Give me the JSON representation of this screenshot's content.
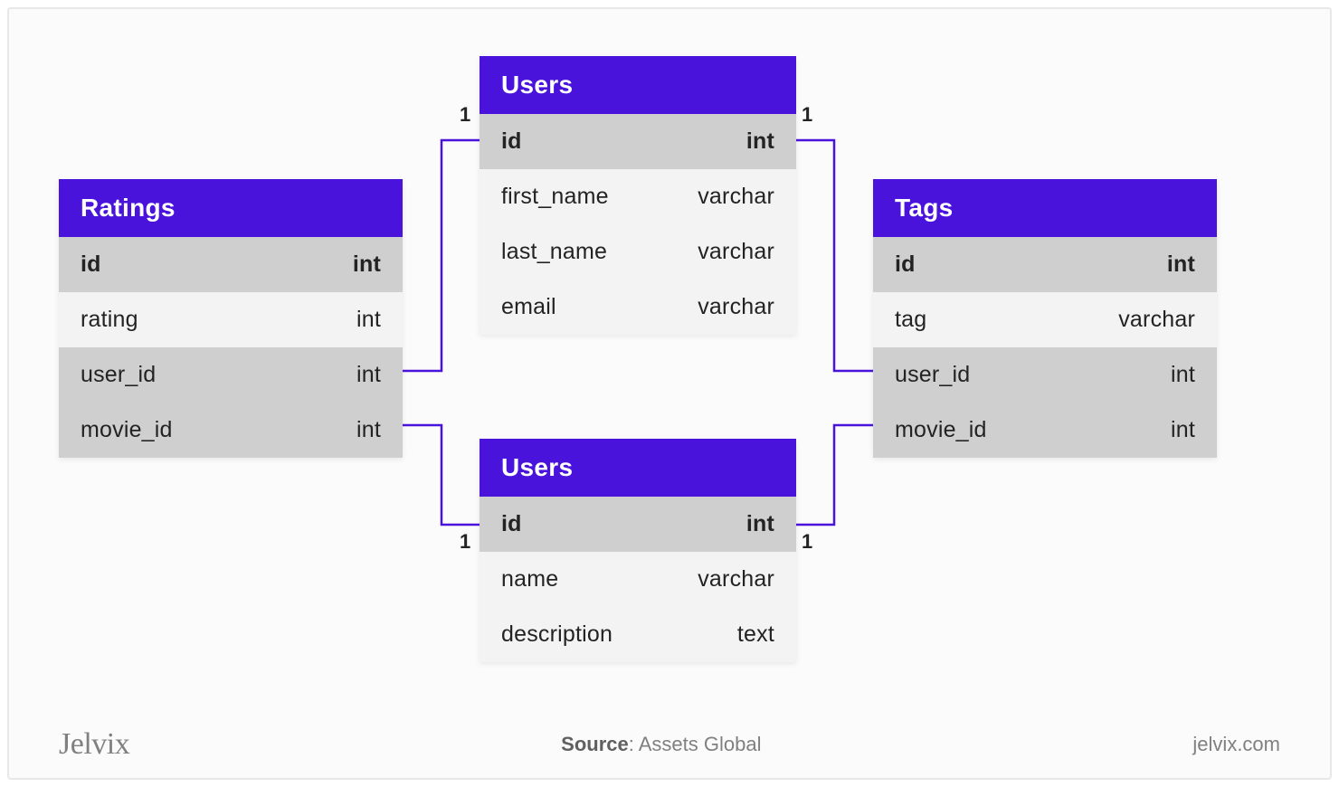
{
  "colors": {
    "accent": "#4a13db",
    "row_bg": "#f3f3f3",
    "key_bg": "#cfcfcf"
  },
  "tables": {
    "ratings": {
      "title": "Ratings",
      "rows": [
        {
          "name": "id",
          "type": "int",
          "key": true
        },
        {
          "name": "rating",
          "type": "int"
        },
        {
          "name": "user_id",
          "type": "int",
          "fk": true
        },
        {
          "name": "movie_id",
          "type": "int",
          "fk": true
        }
      ]
    },
    "users_top": {
      "title": "Users",
      "rows": [
        {
          "name": "id",
          "type": "int",
          "key": true
        },
        {
          "name": "first_name",
          "type": "varchar"
        },
        {
          "name": "last_name",
          "type": "varchar"
        },
        {
          "name": "email",
          "type": "varchar"
        }
      ]
    },
    "users_bottom": {
      "title": "Users",
      "rows": [
        {
          "name": "id",
          "type": "int",
          "key": true
        },
        {
          "name": "name",
          "type": "varchar"
        },
        {
          "name": "description",
          "type": "text"
        }
      ]
    },
    "tags": {
      "title": "Tags",
      "rows": [
        {
          "name": "id",
          "type": "int",
          "key": true
        },
        {
          "name": "tag",
          "type": "varchar"
        },
        {
          "name": "user_id",
          "type": "int",
          "fk": true
        },
        {
          "name": "movie_id",
          "type": "int",
          "fk": true
        }
      ]
    }
  },
  "cardinality": {
    "top_left": "1",
    "top_right": "1",
    "bottom_left": "1",
    "bottom_right": "1"
  },
  "footer": {
    "brand": "Jelvix",
    "source_label": "Source",
    "source_value": "Assets Global",
    "site": "jelvix.com"
  }
}
